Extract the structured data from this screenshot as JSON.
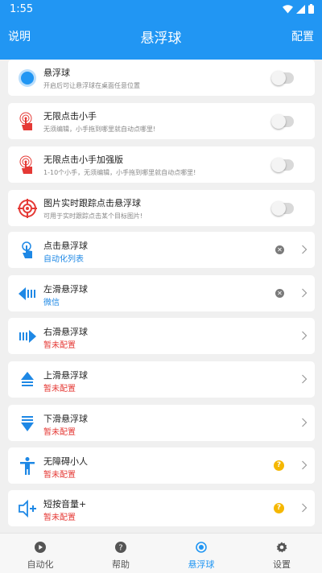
{
  "status": {
    "time": "1:55"
  },
  "appbar": {
    "left": "说明",
    "title": "悬浮球",
    "right": "配置"
  },
  "cards": [
    {
      "kind": "toggle",
      "icon": "blue-circle-icon",
      "title": "悬浮球",
      "subtitle": "开启后可让悬浮球在桌面任意位置",
      "subtitle_style": "gray",
      "enabled": false
    },
    {
      "kind": "toggle",
      "icon": "tap-hand-icon",
      "title": "无限点击小手",
      "subtitle": "无须编辑，小手拖到哪里就自动点哪里!",
      "subtitle_style": "gray",
      "enabled": false
    },
    {
      "kind": "toggle",
      "icon": "tap-hand-icon",
      "title": "无限点击小手加强版",
      "subtitle": "1-10个小手，无须编辑，小手拖到哪里就自动点哪里!",
      "subtitle_style": "gray",
      "enabled": false
    },
    {
      "kind": "toggle",
      "icon": "target-icon",
      "title": "图片实时跟踪点击悬浮球",
      "subtitle": "可用于实时跟踪点击某个目标图片!",
      "subtitle_style": "gray",
      "enabled": false
    },
    {
      "kind": "action",
      "icon": "finger-tap-icon",
      "title": "点击悬浮球",
      "subtitle": "自动化列表",
      "subtitle_style": "blue",
      "badge": "clear",
      "badge_text": "✕"
    },
    {
      "kind": "action",
      "icon": "swipe-left-icon",
      "title": "左滑悬浮球",
      "subtitle": "微信",
      "subtitle_style": "blue",
      "badge": "clear",
      "badge_text": "✕"
    },
    {
      "kind": "action",
      "icon": "swipe-right-icon",
      "title": "右滑悬浮球",
      "subtitle": "暂未配置",
      "subtitle_style": "red",
      "badge": "none",
      "badge_text": ""
    },
    {
      "kind": "action",
      "icon": "swipe-up-icon",
      "title": "上滑悬浮球",
      "subtitle": "暂未配置",
      "subtitle_style": "red",
      "badge": "none",
      "badge_text": ""
    },
    {
      "kind": "action",
      "icon": "swipe-down-icon",
      "title": "下滑悬浮球",
      "subtitle": "暂未配置",
      "subtitle_style": "red",
      "badge": "none",
      "badge_text": ""
    },
    {
      "kind": "action",
      "icon": "accessibility-person-icon",
      "title": "无障碍小人",
      "subtitle": "暂未配置",
      "subtitle_style": "red",
      "badge": "help",
      "badge_text": "?"
    },
    {
      "kind": "action",
      "icon": "volume-up-icon",
      "title": "短按音量+",
      "subtitle": "暂未配置",
      "subtitle_style": "red",
      "badge": "help",
      "badge_text": "?"
    }
  ],
  "tabs": [
    {
      "icon": "play-circle-icon",
      "label": "自动化",
      "active": false
    },
    {
      "icon": "help-circle-icon",
      "label": "帮助",
      "active": false
    },
    {
      "icon": "float-ball-icon",
      "label": "悬浮球",
      "active": true
    },
    {
      "icon": "gear-icon",
      "label": "设置",
      "active": false
    }
  ],
  "colors": {
    "primary": "#2196f3",
    "red": "#e53935",
    "help": "#f5b700",
    "background": "#f0f0f0"
  }
}
